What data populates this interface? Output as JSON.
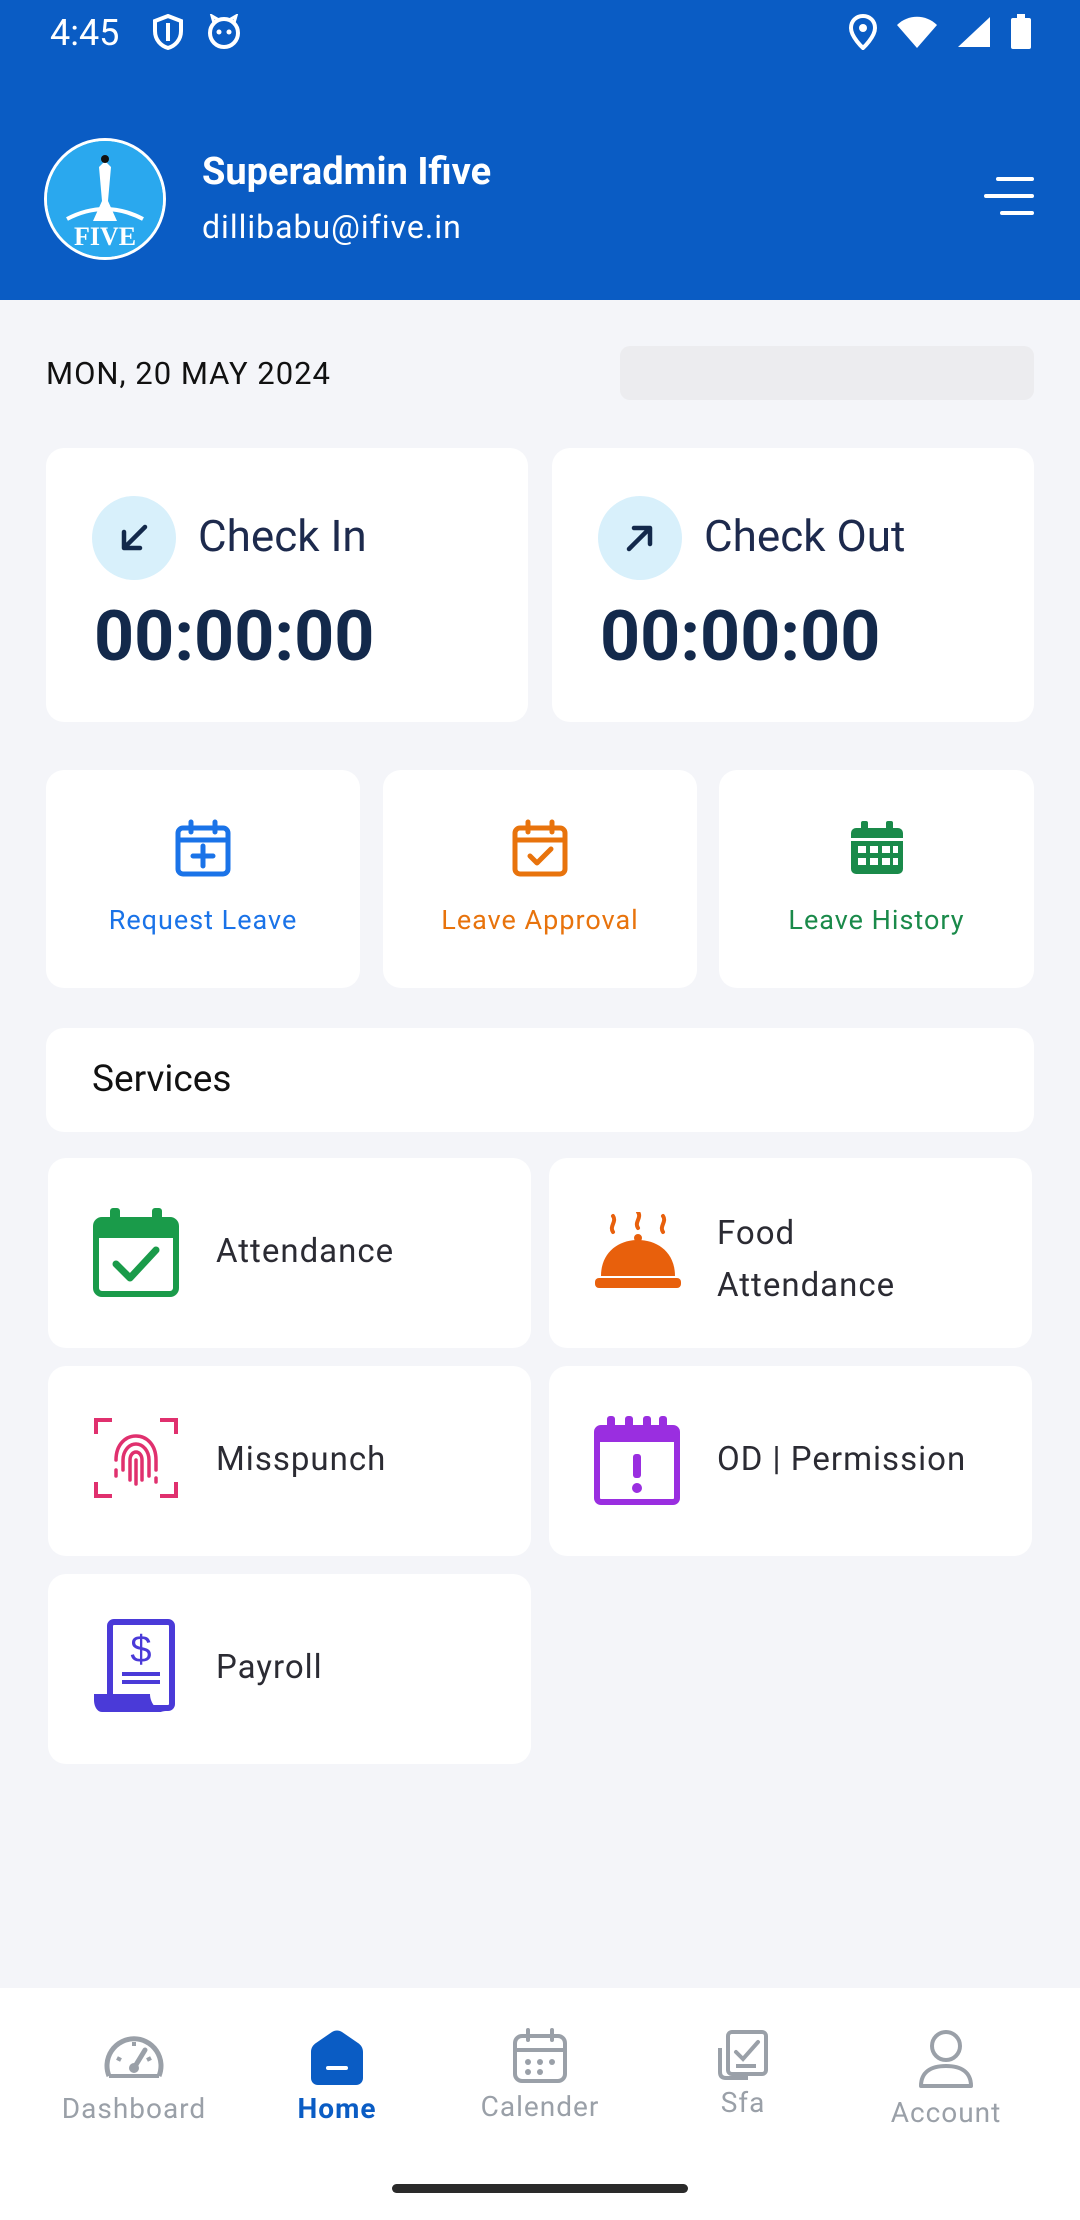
{
  "status_bar": {
    "time": "4:45"
  },
  "header": {
    "user_name": "Superadmin Ifive",
    "user_email": "dillibabu@ifive.in",
    "logo_text": "FIVE"
  },
  "date": "MON, 20 MAY 2024",
  "check_in": {
    "label": "Check In",
    "time": "00:00:00"
  },
  "check_out": {
    "label": "Check Out",
    "time": "00:00:00"
  },
  "leave_actions": [
    {
      "label": "Request Leave",
      "color": "#1a73e8",
      "icon": "calendar-plus-icon"
    },
    {
      "label": "Leave Approval",
      "color": "#e8730c",
      "icon": "calendar-check-icon"
    },
    {
      "label": "Leave History",
      "color": "#1a8a4a",
      "icon": "calendar-grid-icon"
    }
  ],
  "services": {
    "title": "Services",
    "items": [
      {
        "label": "Attendance",
        "icon": "calendar-check-icon"
      },
      {
        "label": "Food\nAttendance",
        "icon": "food-cloche-icon"
      },
      {
        "label": "Misspunch",
        "icon": "fingerprint-icon"
      },
      {
        "label": "OD | Permission",
        "icon": "calendar-alert-icon"
      },
      {
        "label": "Payroll",
        "icon": "payroll-document-icon"
      }
    ]
  },
  "bottom_nav": [
    {
      "label": "Dashboard",
      "icon": "gauge-icon",
      "active": false
    },
    {
      "label": "Home",
      "icon": "home-icon",
      "active": true
    },
    {
      "label": "Calender",
      "icon": "calendar-icon",
      "active": false
    },
    {
      "label": "Sfa",
      "icon": "checklist-icon",
      "active": false
    },
    {
      "label": "Account",
      "icon": "user-icon",
      "active": false
    }
  ],
  "colors": {
    "header_bg": "#0a5cc4",
    "accent": "#0a5cc4",
    "attendance": "#1a9b4a",
    "food": "#e8600c",
    "misspunch": "#e0306e",
    "od": "#9a2ee0",
    "payroll": "#4a3ad8"
  }
}
